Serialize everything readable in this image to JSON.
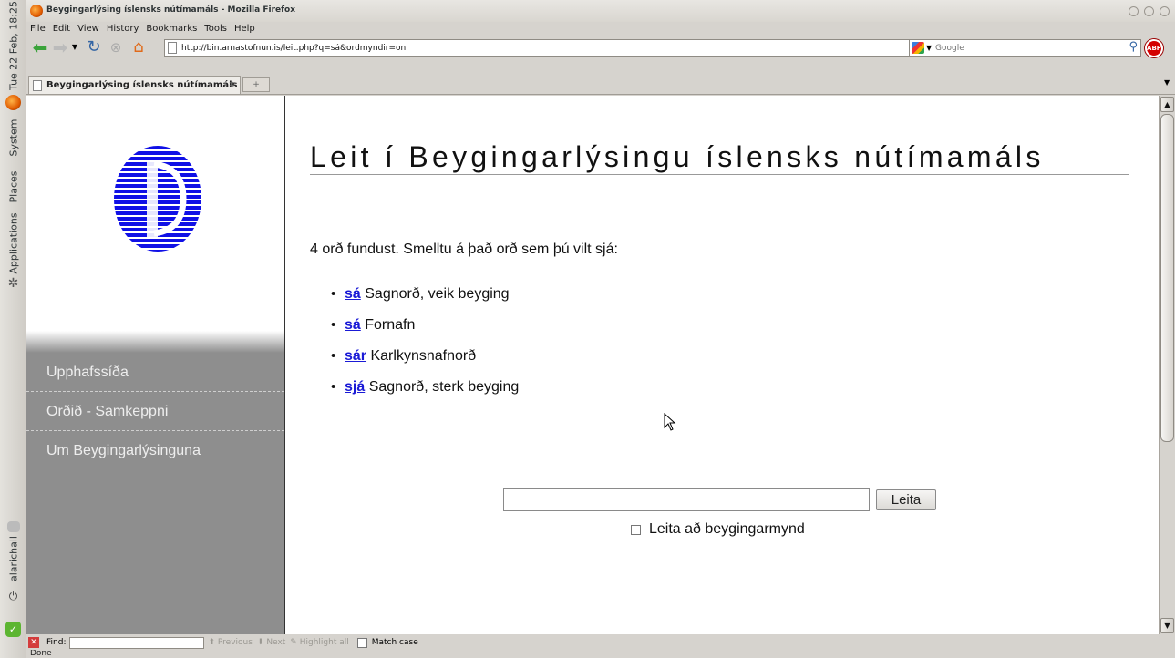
{
  "os_panel": {
    "clock": "Tue 22 Feb, 18:25",
    "system": "System",
    "places": "Places",
    "applications": "Applications",
    "user": "alarichall"
  },
  "window": {
    "title": "Beygingarlýsing íslensks nútímamáls - Mozilla Firefox"
  },
  "menu": [
    "File",
    "Edit",
    "View",
    "History",
    "Bookmarks",
    "Tools",
    "Help"
  ],
  "navbar": {
    "url": "http://bin.arnastofnun.is/leit.php?q=sá&ordmyndir=on",
    "search_placeholder": "Google",
    "abp_label": "ABP"
  },
  "tab": {
    "label": "Beygingarlýsing íslensks nútímamáls"
  },
  "sidebar": {
    "items": [
      {
        "label": "Upphafssíða"
      },
      {
        "label": "Orðið - Samkeppni"
      },
      {
        "label": "Um Beygingarlýsinguna"
      }
    ]
  },
  "main": {
    "title": "Leit í Beygingarlýsingu íslensks nútímamáls",
    "intro": "4 orð fundust. Smelltu á það orð sem þú vilt sjá:",
    "results": [
      {
        "word": "sá",
        "desc": "Sagnorð, veik beyging"
      },
      {
        "word": "sá",
        "desc": "Fornafn"
      },
      {
        "word": "sár",
        "desc": "Karlkynsnafnorð"
      },
      {
        "word": "sjá",
        "desc": "Sagnorð, sterk beyging"
      }
    ],
    "search_value": "",
    "search_button": "Leita",
    "checkbox_label": "Leita að beygingarmynd"
  },
  "findbar": {
    "label": "Find:",
    "previous": "Previous",
    "next": "Next",
    "highlight": "Highlight all",
    "match_case": "Match case"
  },
  "status": "Done",
  "colors": {
    "link": "#1a1ad6",
    "logo_blue": "#1010e6",
    "sidebar_gray": "#8e8e8e"
  }
}
